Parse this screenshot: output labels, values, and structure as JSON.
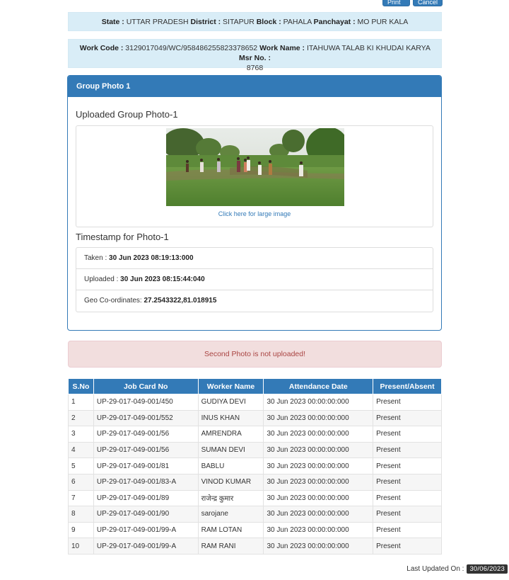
{
  "top_buttons": {
    "print": "⎙ Print",
    "cancel": "Cancel"
  },
  "location": {
    "state_label": "State :",
    "state": "UTTAR PRADESH",
    "district_label": "District :",
    "district": "SITAPUR",
    "block_label": "Block :",
    "block": "PAHALA",
    "panchayat_label": "Panchayat :",
    "panchayat": "MO PUR KALA"
  },
  "work": {
    "code_label": "Work Code :",
    "code": "3129017049/WC/958486255823378652",
    "name_label": "Work Name :",
    "name": "ITAHUWA TALAB KI KHUDAI KARYA",
    "msr_label": "Msr No. :",
    "msr": "8768"
  },
  "panel": {
    "heading": "Group Photo 1",
    "uploaded_title": "Uploaded Group Photo-1",
    "large_image_link": "Click here for large image",
    "timestamp_title": "Timestamp for Photo-1",
    "taken_label": "Taken :",
    "taken": "30 Jun 2023 08:19:13:000",
    "uploaded_label": "Uploaded :",
    "uploaded": "30 Jun 2023 08:15:44:040",
    "geo_label": "Geo Co-ordinates:",
    "geo": "27.2543322,81.018915"
  },
  "alert": {
    "message": "Second Photo is not uploaded!"
  },
  "table": {
    "headers": [
      "S.No",
      "Job Card No",
      "Worker Name",
      "Attendance Date",
      "Present/Absent"
    ],
    "rows": [
      [
        "1",
        "UP-29-017-049-001/450",
        "GUDIYA DEVI",
        "30 Jun 2023 00:00:00:000",
        "Present"
      ],
      [
        "2",
        "UP-29-017-049-001/552",
        "INUS KHAN",
        "30 Jun 2023 00:00:00:000",
        "Present"
      ],
      [
        "3",
        "UP-29-017-049-001/56",
        "AMRENDRA",
        "30 Jun 2023 00:00:00:000",
        "Present"
      ],
      [
        "4",
        "UP-29-017-049-001/56",
        "SUMAN DEVI",
        "30 Jun 2023 00:00:00:000",
        "Present"
      ],
      [
        "5",
        "UP-29-017-049-001/81",
        "BABLU",
        "30 Jun 2023 00:00:00:000",
        "Present"
      ],
      [
        "6",
        "UP-29-017-049-001/83-A",
        "VINOD KUMAR",
        "30 Jun 2023 00:00:00:000",
        "Present"
      ],
      [
        "7",
        "UP-29-017-049-001/89",
        "राजेन्द्र कुमार",
        "30 Jun 2023 00:00:00:000",
        "Present"
      ],
      [
        "8",
        "UP-29-017-049-001/90",
        "sarojane",
        "30 Jun 2023 00:00:00:000",
        "Present"
      ],
      [
        "9",
        "UP-29-017-049-001/99-A",
        "RAM LOTAN",
        "30 Jun 2023 00:00:00:000",
        "Present"
      ],
      [
        "10",
        "UP-29-017-049-001/99-A",
        "RAM RANI",
        "30 Jun 2023 00:00:00:000",
        "Present"
      ]
    ]
  },
  "footer": {
    "label": "Last Updated On :",
    "date": "30/06/2023"
  },
  "colors": {
    "primary": "#337ab7",
    "info_bg": "#d9edf7",
    "danger_bg": "#f2dede",
    "danger_text": "#a94442"
  }
}
